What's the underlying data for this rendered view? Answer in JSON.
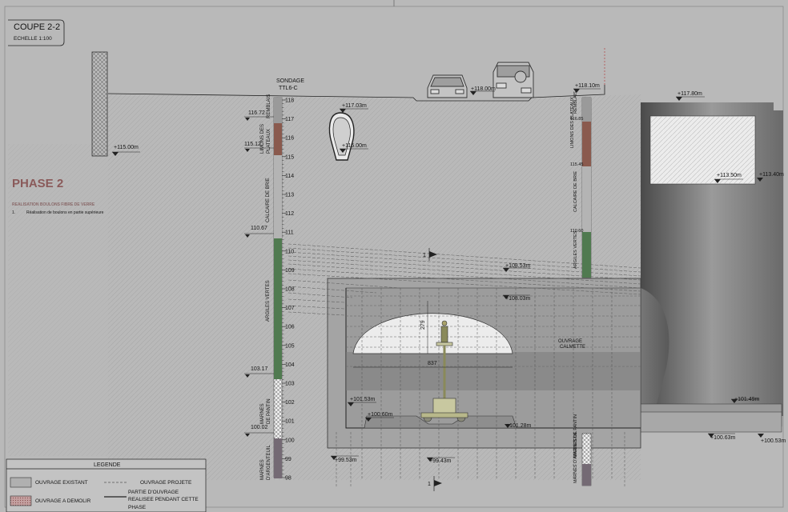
{
  "title_block": {
    "title": "COUPE 2-2",
    "scale": "ECHELLE  1:100"
  },
  "phase": {
    "title": "PHASE 2",
    "subtitle": "REALISATION BOULONS FIBRE DE VERRE",
    "step_number": "1.",
    "step_text": "Réalisation de boulons en partie supérieure"
  },
  "borehole": {
    "label_line1": "SONDAGE",
    "label_line2": "TTL6-C",
    "scale_ticks": [
      "118",
      "117",
      "116",
      "115",
      "114",
      "113",
      "112",
      "111",
      "110",
      "109",
      "108",
      "107",
      "106",
      "105",
      "104",
      "103",
      "102",
      "101",
      "100",
      "99",
      "98"
    ],
    "boundary_levels": [
      "116.72",
      "115.12",
      "110.67",
      "103.17",
      "100.02"
    ],
    "strata": [
      {
        "name": "REMBLAIS",
        "color": "#8a8a8a"
      },
      {
        "name": "LIMONS DES PLATEAUX",
        "color": "#8a5a4e"
      },
      {
        "name": "CALCAIRE DE BRIE",
        "color": "#b0b0b0"
      },
      {
        "name": "ARGILES VERTES",
        "color": "#507a50"
      },
      {
        "name": "MARNES DE PANTIN",
        "color": "#a69a9a"
      },
      {
        "name": "MARNES D'ARGENTEUIL",
        "color": "#746a74"
      }
    ]
  },
  "elevations": {
    "road": "+118.00m",
    "right_road": "+118.10m",
    "ground_left": "+115.00m",
    "ovoid_top": "+117.03m",
    "ovoid_bottom": "+115.00m",
    "building_top": "+117.80m",
    "building_slab": "+113.50m",
    "building_right": "+113.40m",
    "tunnel_top": "+108.53m",
    "vault_top": "+108.03m",
    "bottom_left_1": "+101.53m",
    "bottom_left_2": "+100.60m",
    "bottom_center": "+101.28m",
    "base_left": "+99.53m",
    "base_center": "+99.43m",
    "right_slab": "+101.49m",
    "right_base_1": "+100.63m",
    "right_base_2": "+100.53m"
  },
  "dimensions": {
    "arch_height": "279",
    "arch_width": "837"
  },
  "section_marks": {
    "upper": "1",
    "lower": "1"
  },
  "ouvrage": {
    "line1": "OUVRAGE",
    "line2": "CALMETTE"
  },
  "right_strata_labels": [
    "REMBLAIS",
    "LIMONS DES PLATEAUX",
    "116.85",
    "115.45",
    "CALCAIRE DE BRIE",
    "110.60",
    "ARGILES VERTES",
    "MARNES DE PANTIN",
    "MARNES D'ARGENTEUIL"
  ],
  "legend": {
    "title": "LEGENDE",
    "existing": "OUVRAGE EXISTANT",
    "demolish": "OUVRAGE A  DEMOLIR",
    "projected": "OUVRAGE PROJETE",
    "partial_line1": "PARTIE D'OUVRAGE",
    "partial_line2": "REALISEE PENDANT CETTE",
    "partial_line3": "PHASE"
  },
  "colors": {
    "background": "#b9b9b9",
    "ink": "#141414",
    "rock": "#ececec",
    "green_layer": "#507a50",
    "brown_layer": "#8a5a4e"
  }
}
